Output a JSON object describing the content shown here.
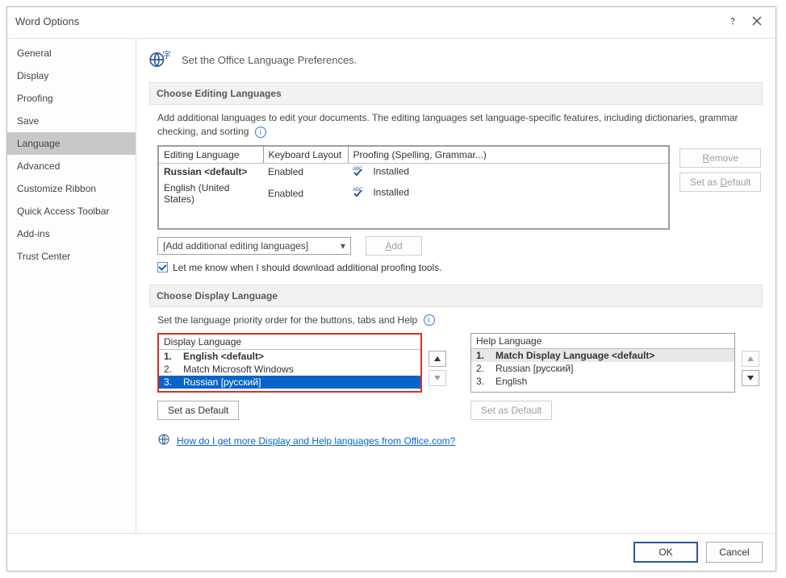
{
  "window": {
    "title": "Word Options"
  },
  "sidebar": {
    "items": [
      "General",
      "Display",
      "Proofing",
      "Save",
      "Language",
      "Advanced",
      "Customize Ribbon",
      "Quick Access Toolbar",
      "Add-ins",
      "Trust Center"
    ],
    "selected_index": 4
  },
  "header": {
    "text": "Set the Office Language Preferences."
  },
  "editing": {
    "section_title": "Choose Editing Languages",
    "description": "Add additional languages to edit your documents. The editing languages set language-specific features, including dictionaries, grammar checking, and sorting",
    "columns": {
      "c0": "Editing Language",
      "c1": "Keyboard Layout",
      "c2": "Proofing (Spelling, Grammar...)"
    },
    "rows": [
      {
        "lang": "Russian <default>",
        "kb": "Enabled",
        "proof": "Installed",
        "bold": true
      },
      {
        "lang": "English (United States)",
        "kb": "Enabled",
        "proof": "Installed",
        "bold": false
      }
    ],
    "remove_label": "Remove",
    "set_default_label": "Set as Default",
    "add_select_text": "[Add additional editing languages]",
    "add_button": "Add",
    "checkbox_label": "Let me know when I should download additional proofing tools."
  },
  "display": {
    "section_title": "Choose Display Language",
    "description": "Set the language priority order for the buttons, tabs and Help",
    "display_box": {
      "head": "Display Language",
      "items": [
        "English <default>",
        "Match Microsoft Windows",
        "Russian [русский]"
      ],
      "selected_index": 2
    },
    "help_box": {
      "head": "Help Language",
      "items": [
        "Match Display Language <default>",
        "Russian [русский]",
        "English"
      ],
      "selected_index": 0
    },
    "set_default_label": "Set as Default",
    "link_text": "How do I get more Display and Help languages from Office.com?"
  },
  "footer": {
    "ok": "OK",
    "cancel": "Cancel"
  }
}
